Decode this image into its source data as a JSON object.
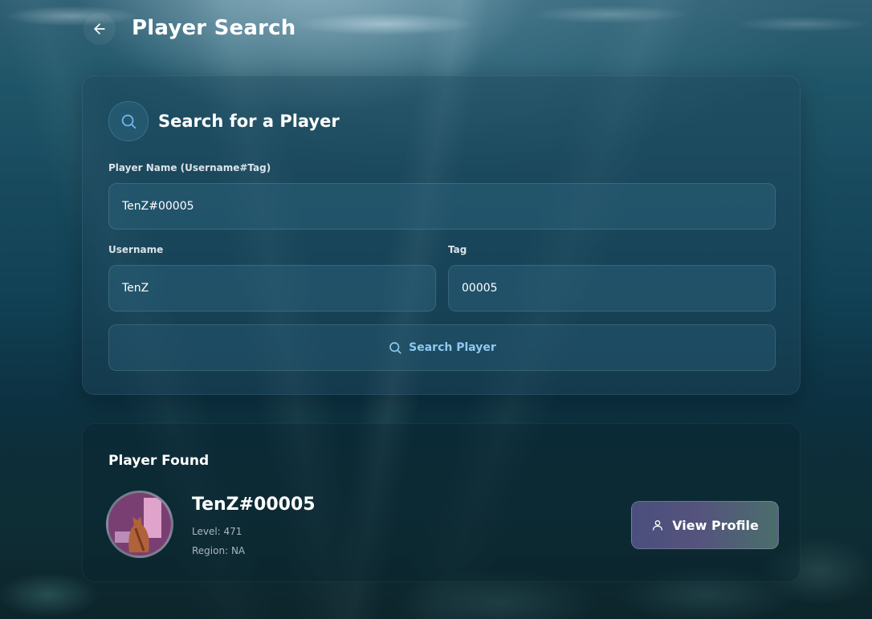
{
  "header": {
    "title": "Player Search"
  },
  "search_card": {
    "title": "Search for a Player",
    "full_name_label": "Player Name (Username#Tag)",
    "full_name_value": "TenZ#00005",
    "username_label": "Username",
    "username_value": "TenZ",
    "tag_label": "Tag",
    "tag_value": "00005",
    "submit_label": "Search Player"
  },
  "result": {
    "title": "Player Found",
    "player_name": "TenZ#00005",
    "level_text": "Level: 471",
    "region_text": "Region: NA",
    "view_profile_label": "View Profile"
  },
  "icons": {
    "back": "arrow-left-icon",
    "search": "search-icon",
    "profile": "user-icon"
  },
  "colors": {
    "accent_blue": "#8ec9f0",
    "button_gradient_start": "#4a4f7d",
    "button_gradient_end": "#4a6e6c"
  }
}
